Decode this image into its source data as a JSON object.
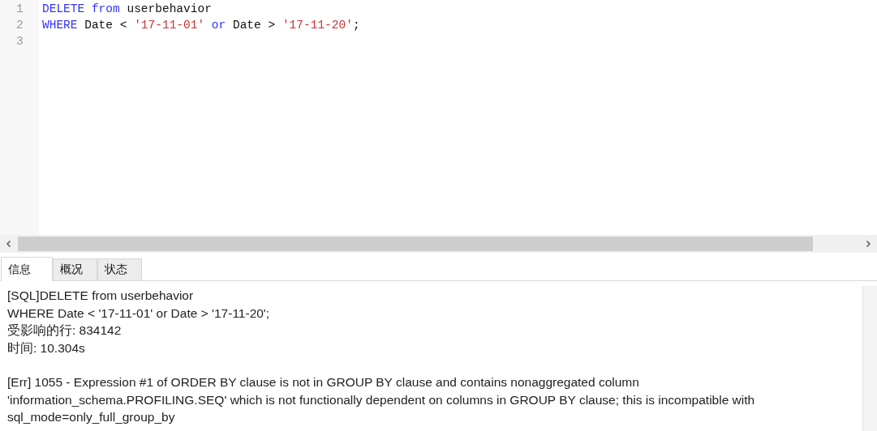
{
  "editor": {
    "lines": [
      {
        "number": "1",
        "tokens": [
          {
            "text": "DELETE",
            "kind": "keyword"
          },
          {
            "text": " from",
            "kind": "keyword"
          },
          {
            "text": " userbehavior",
            "kind": "plain"
          }
        ]
      },
      {
        "number": "2",
        "tokens": [
          {
            "text": "WHERE",
            "kind": "keyword"
          },
          {
            "text": " Date < ",
            "kind": "plain"
          },
          {
            "text": "'17-11-01'",
            "kind": "string"
          },
          {
            "text": " or",
            "kind": "keyword"
          },
          {
            "text": " Date > ",
            "kind": "plain"
          },
          {
            "text": "'17-11-20'",
            "kind": "string"
          },
          {
            "text": ";",
            "kind": "plain"
          }
        ]
      },
      {
        "number": "3"
      }
    ]
  },
  "tabs": [
    {
      "label": "信息",
      "selected": true
    },
    {
      "label": "概况",
      "selected": false
    },
    {
      "label": "状态",
      "selected": false
    }
  ],
  "messages": [
    {
      "lines": [
        "[SQL]DELETE from userbehavior",
        "WHERE Date < '17-11-01' or Date > '17-11-20';",
        "受影响的行: 834142",
        "时间: 10.304s"
      ]
    },
    {
      "lines": [
        "[Err] 1055 - Expression #1 of ORDER BY clause is not in GROUP BY clause and contains nonaggregated column 'information_schema.PROFILING.SEQ' which is not functionally dependent on columns in GROUP BY clause; this is incompatible with sql_mode=only_full_group_by"
      ]
    }
  ]
}
